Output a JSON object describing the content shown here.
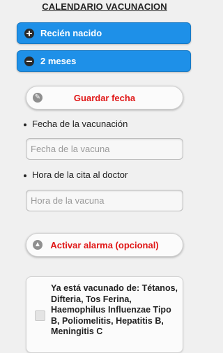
{
  "header": {
    "title": "CALENDARIO VACUNACION"
  },
  "sections": [
    {
      "label": "Recién nacido",
      "icon": "plus-icon",
      "expanded": false
    },
    {
      "label": "2 meses",
      "icon": "minus-icon",
      "expanded": true
    }
  ],
  "form": {
    "save_button": {
      "label": "Guardar fecha",
      "icon": "pencil-icon"
    },
    "date_label": "Fecha de la vacunación",
    "date_placeholder": "Fecha de la vacuna",
    "time_label": "Hora de la cita al doctor",
    "time_placeholder": "Hora de la vacuna",
    "alarm_button": {
      "label": "Activar alarma (opcional)",
      "icon": "alert-icon"
    },
    "vaccinated_checkbox": {
      "checked": false,
      "label": "Ya está vacunado de: Tétanos, Difteria, Tos Ferina, Haemophilus Influenzae Tipo B, Poliomelitis, Hepatitis B, Meningitis C"
    }
  },
  "colors": {
    "accent": "#1e90e8",
    "button_text": "#e01616"
  }
}
